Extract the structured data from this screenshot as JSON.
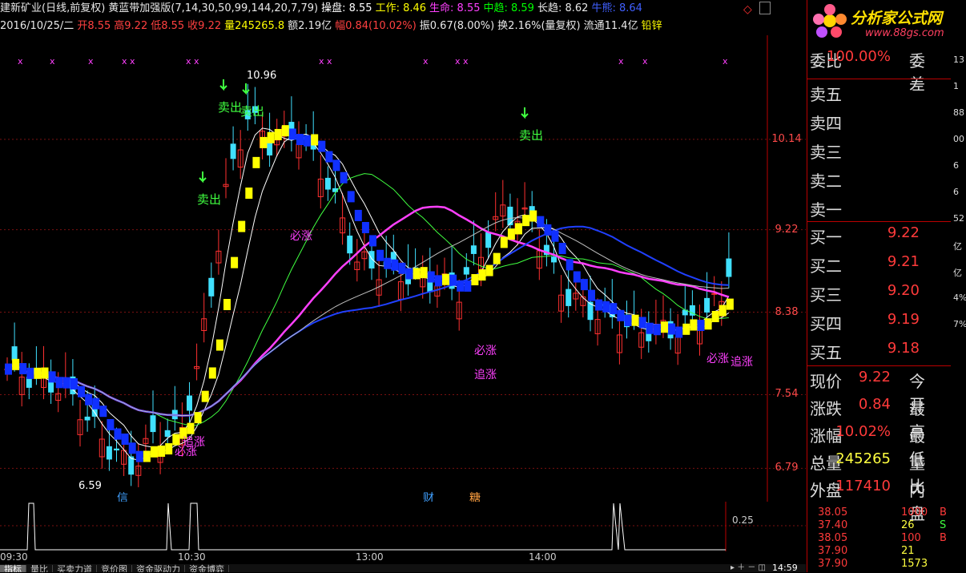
{
  "header": {
    "line1": [
      {
        "text": "建新矿业(日线,前复权)",
        "color": "#e8e8e8"
      },
      {
        "text": "黄蓝带加强版(7,14,30,50,99,144,20,7,79)",
        "color": "#e8e8e8"
      },
      {
        "text": "操盘: 8.55",
        "color": "#ffffff"
      },
      {
        "text": "工作: 8.46",
        "color": "#ffff00"
      },
      {
        "text": "生命: 8.55",
        "color": "#ff40ff"
      },
      {
        "text": "中趋: 8.59",
        "color": "#00ff00"
      },
      {
        "text": "长趋: 8.62",
        "color": "#e8e8e8"
      },
      {
        "text": "牛熊: 8.64",
        "color": "#4060ff"
      }
    ],
    "line2": [
      {
        "text": "2016/10/25/二",
        "color": "#e8e8e8"
      },
      {
        "text": "开8.55",
        "color": "#ff4040"
      },
      {
        "text": "高9.22",
        "color": "#ff4040"
      },
      {
        "text": "低8.55",
        "color": "#ff4040"
      },
      {
        "text": "收9.22",
        "color": "#ff4040"
      },
      {
        "text": "量245265.8",
        "color": "#ffff00"
      },
      {
        "text": "额2.19亿",
        "color": "#e8e8e8"
      },
      {
        "text": "幅0.84(10.02%)",
        "color": "#ff4040"
      },
      {
        "text": "振0.67(8.00%)",
        "color": "#e8e8e8"
      },
      {
        "text": "换2.16%(量复权)",
        "color": "#e8e8e8"
      },
      {
        "text": "流通11.4亿",
        "color": "#e8e8e8"
      },
      {
        "text": "铅锌",
        "color": "#ffff00"
      }
    ]
  },
  "price_axis": [
    "10.14",
    "9.22",
    "8.38",
    "7.54",
    "6.79"
  ],
  "indicator_axis": "0.25",
  "time_axis": [
    "09:30",
    "10:30",
    "13:00",
    "14:00"
  ],
  "annotations": {
    "sell": "卖出",
    "rise": "必涨",
    "chase": "追涨",
    "high_label": "10.96",
    "low_label": "6.59",
    "cai": "财",
    "tang": "糖",
    "xin": "信"
  },
  "tabs": [
    "指标",
    "量比",
    "买卖力道",
    "竞价图",
    "资金驱动力",
    "资金博弈"
  ],
  "order_book": {
    "weibi_label": "委比",
    "weibi_value": "100.00%",
    "weicha_label": "委差",
    "sell": [
      {
        "label": "卖五",
        "price": ""
      },
      {
        "label": "卖四",
        "price": ""
      },
      {
        "label": "卖三",
        "price": ""
      },
      {
        "label": "卖二",
        "price": ""
      },
      {
        "label": "卖一",
        "price": ""
      }
    ],
    "buy": [
      {
        "label": "买一",
        "price": "9.22"
      },
      {
        "label": "买二",
        "price": "9.21"
      },
      {
        "label": "买三",
        "price": "9.20"
      },
      {
        "label": "买四",
        "price": "9.19"
      },
      {
        "label": "买五",
        "price": "9.18"
      }
    ],
    "stats": [
      {
        "label": "现价",
        "value": "9.22",
        "label2": "今开",
        "color": "#ff3a3a"
      },
      {
        "label": "涨跌",
        "value": "0.84",
        "label2": "最高",
        "color": "#ff3a3a"
      },
      {
        "label": "涨幅",
        "value": "10.02%",
        "label2": "最低",
        "color": "#ff3a3a"
      },
      {
        "label": "总量",
        "value": "245265",
        "label2": "量比",
        "color": "#ffff40"
      },
      {
        "label": "外盘",
        "value": "117410",
        "label2": "内盘",
        "color": "#ff3a3a"
      }
    ]
  },
  "right_edge": [
    "13",
    "1",
    "88",
    "00",
    "6",
    "6",
    "52",
    "亿",
    "亿",
    "4%",
    "7%"
  ],
  "trades": [
    {
      "price": "38.05",
      "vol": "1000",
      "flag": "B"
    },
    {
      "price": "37.40",
      "vol": "26",
      "flag": "S"
    },
    {
      "price": "38.05",
      "vol": "100",
      "flag": "B"
    },
    {
      "price": "37.90",
      "vol": "21",
      "flag": ""
    },
    {
      "price": "37.90",
      "vol": "1573",
      "flag": ""
    }
  ],
  "clock": "14:59",
  "logo": {
    "title": "分析家公式网",
    "url": "www.88gs.com"
  },
  "chart_data": {
    "type": "candlestick",
    "y_ticks": [
      10.14,
      9.22,
      8.38,
      7.54,
      6.79
    ],
    "ylim": [
      6.45,
      11.2
    ],
    "x_ticks": [
      "09:30",
      "10:30",
      "13:00",
      "14:00"
    ]
  }
}
